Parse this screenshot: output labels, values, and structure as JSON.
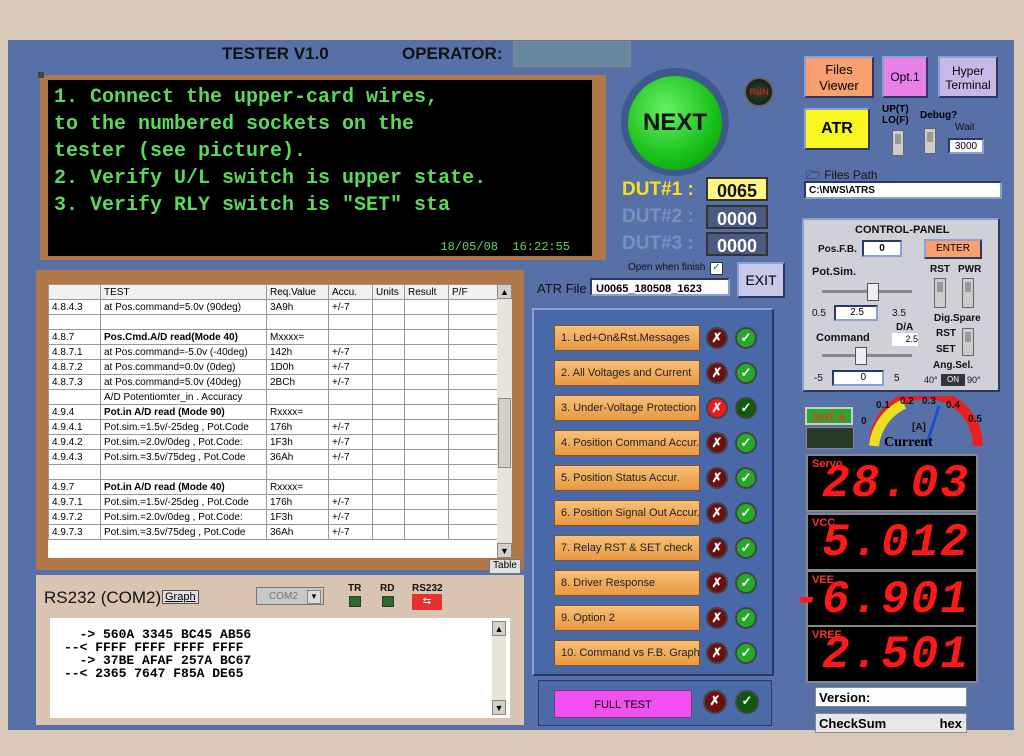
{
  "header": {
    "title": "TESTER V1.0",
    "operator_label": "OPERATOR:",
    "operator_value": ""
  },
  "message": {
    "lines": "1. Connect the upper-card wires,\nto the numbered sockets on the\ntester (see picture).\n2. Verify U/L switch is upper state.\n3. Verify RLY switch is \"SET\" sta",
    "date": "18/05/08",
    "time": "16:22:55"
  },
  "next": {
    "label": "NEXT"
  },
  "run": {
    "label": "RUN"
  },
  "dut": [
    {
      "label": "DUT#1 :",
      "value": "0065"
    },
    {
      "label": "DUT#2 :",
      "value": "0000"
    },
    {
      "label": "DUT#3 :",
      "value": "0000"
    }
  ],
  "open_when_finish": "Open when finish",
  "exit": "EXIT",
  "atr": {
    "label": "ATR File",
    "value": "U0065_180508_1623"
  },
  "buttons": {
    "files_viewer": "Files Viewer",
    "opt1": "Opt.1",
    "hyper_terminal": "Hyper Terminal",
    "atr": "ATR"
  },
  "switches": {
    "uplo": "UP(T) LO(F)",
    "debug": "Debug?",
    "wait": "Wait",
    "wait_value": "3000"
  },
  "files_path": {
    "label": "Files Path",
    "value": "C:\\NWS\\ATRS"
  },
  "control_panel": {
    "title": "CONTROL-PANEL",
    "posfb_label": "Pos.F.B.",
    "posfb_value": "0",
    "enter": "ENTER",
    "potsim": "Pot.Sim.",
    "rst": "RST",
    "pwr": "PWR",
    "pot_min": "0.5",
    "pot_val": "2.5",
    "pot_max": "3.5",
    "da_label": "D/A",
    "da_value": "2.5",
    "digspare": "Dig.Spare",
    "rst2": "RST",
    "set": "SET",
    "command": "Command",
    "cmd_min": "-5",
    "cmd_val": "0",
    "cmd_max": "5",
    "angsel": "Ang.Sel.",
    "ang_40": "40°",
    "ang_on": "ON",
    "ang_90": "90°"
  },
  "dut_a": "DUT A",
  "gauge": {
    "label": "Current",
    "unit": "[A]",
    "ticks": [
      "0",
      "0.1",
      "0.2",
      "0.3",
      "0.4",
      "0.5"
    ],
    "value": 0.3
  },
  "displays": [
    {
      "label": "Servo",
      "value": "28.03"
    },
    {
      "label": "VCC",
      "value": "5.012"
    },
    {
      "label": "VEE",
      "value": "-6.901"
    },
    {
      "label": "VREF",
      "value": "2.501"
    }
  ],
  "version_label": "Version:",
  "checksum": {
    "label": "CheckSum",
    "unit": "hex"
  },
  "table": {
    "headers": [
      "",
      "TEST",
      "Req.Value",
      "Accu.",
      "Units",
      "Result",
      "P/F"
    ],
    "rows": [
      {
        "bold": false,
        "c": [
          "4.8.4.3",
          "at Pos.command=5.0v (90deg)",
          "3A9h",
          "+/-7",
          "",
          "",
          ""
        ]
      },
      {
        "bold": false,
        "c": [
          "",
          "",
          "",
          "",
          "",
          "",
          ""
        ]
      },
      {
        "bold": true,
        "c": [
          "4.8.7",
          "Pos.Cmd.A/D read(Mode 40)",
          "Mxxxx=",
          "",
          "",
          "",
          ""
        ]
      },
      {
        "bold": false,
        "c": [
          "4.8.7.1",
          "at Pos.command=-5.0v (-40deg)",
          "142h",
          "+/-7",
          "",
          "",
          ""
        ]
      },
      {
        "bold": false,
        "c": [
          "4.8.7.2",
          "at Pos.command=0.0v (0deg)",
          "1D0h",
          "+/-7",
          "",
          "",
          ""
        ]
      },
      {
        "bold": false,
        "c": [
          "4.8.7.3",
          "at Pos.command=5.0v (40deg)",
          "2BCh",
          "+/-7",
          "",
          "",
          ""
        ]
      },
      {
        "bold": false,
        "c": [
          "",
          "A/D Potentiomter_in . Accuracy",
          "",
          "",
          "",
          "",
          ""
        ]
      },
      {
        "bold": true,
        "c": [
          "4.9.4",
          "Pot.in A/D read (Mode 90)",
          "Rxxxx=",
          "",
          "",
          "",
          ""
        ]
      },
      {
        "bold": false,
        "c": [
          "4.9.4.1",
          "Pot.sim.=1.5v/-25deg , Pot.Code",
          "176h",
          "+/-7",
          "",
          "",
          ""
        ]
      },
      {
        "bold": false,
        "c": [
          "4.9.4.2",
          "Pot.sim.=2.0v/0deg , Pot.Code:",
          "1F3h",
          "+/-7",
          "",
          "",
          ""
        ]
      },
      {
        "bold": false,
        "c": [
          "4.9.4.3",
          "Pot.sim.=3.5v/75deg , Pot.Code",
          "36Ah",
          "+/-7",
          "",
          "",
          ""
        ]
      },
      {
        "bold": false,
        "c": [
          "",
          "",
          "",
          "",
          "",
          "",
          ""
        ]
      },
      {
        "bold": true,
        "c": [
          "4.9.7",
          "Pot.in A/D read (Mode 40)",
          "Rxxxx=",
          "",
          "",
          "",
          ""
        ]
      },
      {
        "bold": false,
        "c": [
          "4.9.7.1",
          "Pot.sim.=1.5v/-25deg , Pot.Code",
          "176h",
          "+/-7",
          "",
          "",
          ""
        ]
      },
      {
        "bold": false,
        "c": [
          "4.9.7.2",
          "Pot.sim.=2.0v/0deg , Pot.Code:",
          "1F3h",
          "+/-7",
          "",
          "",
          ""
        ]
      },
      {
        "bold": false,
        "c": [
          "4.9.7.3",
          "Pot.sim.=3.5v/75deg , Pot.Code",
          "36Ah",
          "+/-7",
          "",
          "",
          ""
        ]
      }
    ],
    "table_button": "Table"
  },
  "rs232": {
    "title": "RS232 (COM2)",
    "graph": "Graph",
    "port": "COM2",
    "tr": "TR",
    "rd": "RD",
    "rs232": "RS232",
    "log": "  -> 560A 3345 BC45 AB56\n--< FFFF FFFF FFFF FFFF\n  -> 37BE AFAF 257A BC67\n--< 2365 7647 F85A DE65"
  },
  "tests": [
    {
      "label": "1. Led+On&Rst.Messages",
      "fail": false,
      "pass": true
    },
    {
      "label": "2. All Voltages and Current",
      "fail": false,
      "pass": true
    },
    {
      "label": "3. Under-Voltage Protection",
      "fail": true,
      "pass": false
    },
    {
      "label": "4. Position Command Accur.",
      "fail": false,
      "pass": true
    },
    {
      "label": "5. Position Status Accur.",
      "fail": false,
      "pass": true
    },
    {
      "label": "6. Position Signal Out Accur.",
      "fail": false,
      "pass": true
    },
    {
      "label": "7. Relay RST & SET check",
      "fail": false,
      "pass": true
    },
    {
      "label": "8. Driver Response",
      "fail": false,
      "pass": true
    },
    {
      "label": "9. Option 2",
      "fail": false,
      "pass": true
    },
    {
      "label": "10. Command vs F.B. Graph",
      "fail": false,
      "pass": true
    }
  ],
  "full_test": "FULL TEST"
}
